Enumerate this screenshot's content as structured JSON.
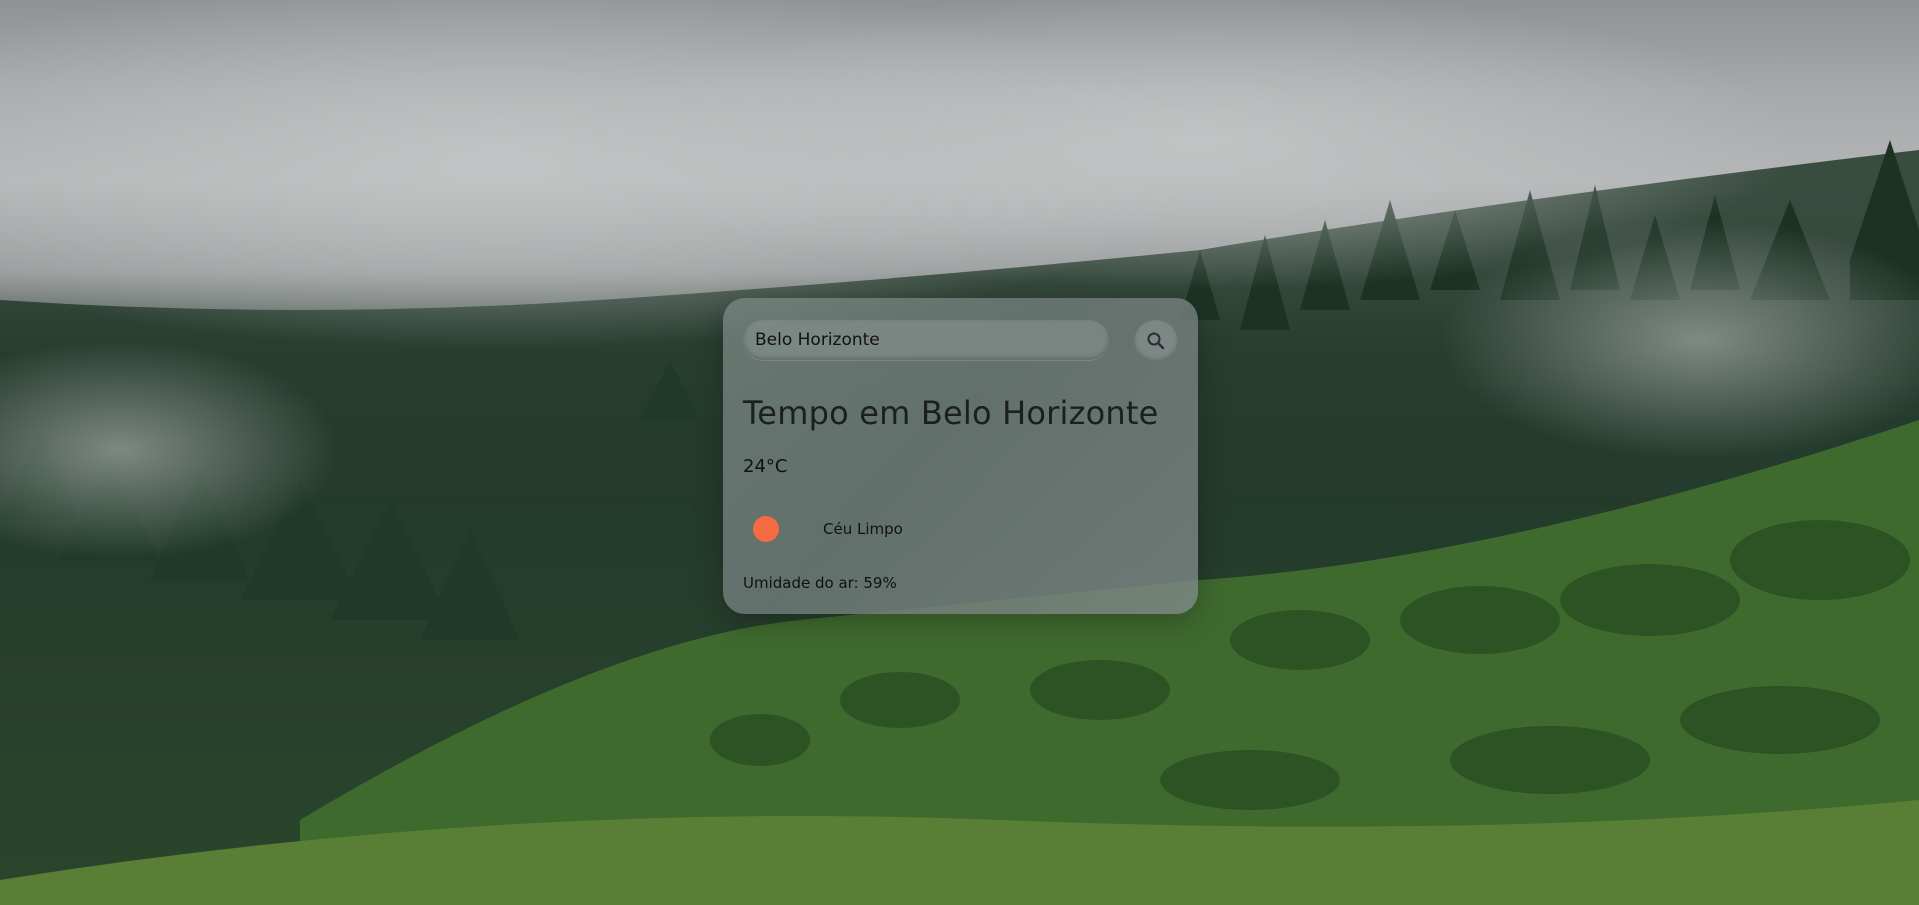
{
  "search": {
    "value": "Belo Horizonte",
    "placeholder": ""
  },
  "weather": {
    "title": "Tempo em Belo Horizonte",
    "temperature": "24°C",
    "condition": "Céu Limpo",
    "humidity": "Umidade do ar: 59%"
  },
  "colors": {
    "condition_icon": "#f46a43"
  },
  "icons": {
    "search_button": "search-icon",
    "condition": "sun-icon"
  }
}
